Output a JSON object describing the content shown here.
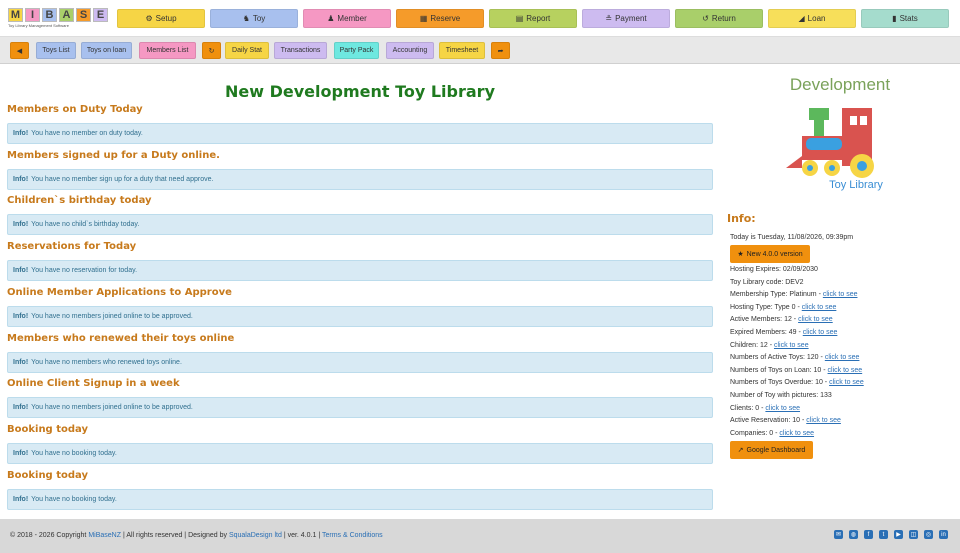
{
  "logo": {
    "letters": [
      "M",
      "I",
      "B",
      "A",
      "S",
      "E"
    ],
    "tagline": "Toy Library Management Software"
  },
  "nav": [
    {
      "label": "Setup",
      "icon": "gear-icon",
      "glyph": "⚙",
      "color": "#f6d545"
    },
    {
      "label": "Toy",
      "icon": "bicycle-icon",
      "glyph": "♞",
      "color": "#a8c0ee"
    },
    {
      "label": "Member",
      "icon": "users-icon",
      "glyph": "♟",
      "color": "#f598c3"
    },
    {
      "label": "Reserve",
      "icon": "calendar-icon",
      "glyph": "▦",
      "color": "#f59b2a"
    },
    {
      "label": "Report",
      "icon": "report-icon",
      "glyph": "▤",
      "color": "#b7d15f"
    },
    {
      "label": "Payment",
      "icon": "payment-icon",
      "glyph": "≗",
      "color": "#cdbbf0"
    },
    {
      "label": "Return",
      "icon": "return-icon",
      "glyph": "↺",
      "color": "#a9cf6a"
    },
    {
      "label": "Loan",
      "icon": "send-icon",
      "glyph": "◢",
      "color": "#f7df5a"
    },
    {
      "label": "Stats",
      "icon": "bar-chart-icon",
      "glyph": "▮",
      "color": "#a5dccd"
    }
  ],
  "subnav": [
    {
      "label": "",
      "name": "back-button",
      "glyph": "◀",
      "color": "#f0900e"
    },
    {
      "label": "Toys List",
      "name": "toys-list-button",
      "color": "#a8c0ee"
    },
    {
      "label": "Toys on loan",
      "name": "toys-on-loan-button",
      "color": "#a8c0ee"
    },
    {
      "label": "Members List",
      "name": "members-list-button",
      "color": "#f598c3"
    },
    {
      "label": "",
      "name": "refresh-button",
      "glyph": "↻",
      "color": "#f0900e"
    },
    {
      "label": "Daily Stat",
      "name": "daily-stat-button",
      "color": "#f6d545"
    },
    {
      "label": "Transactions",
      "name": "transactions-button",
      "color": "#cdbbf0"
    },
    {
      "label": "Party Pack",
      "name": "party-pack-button",
      "color": "#6ee8e0"
    },
    {
      "label": "Accounting",
      "name": "accounting-button",
      "color": "#cdbbf0"
    },
    {
      "label": "Timesheet",
      "name": "timesheet-button",
      "color": "#f6d545"
    },
    {
      "label": "",
      "name": "logout-button",
      "glyph": "➦",
      "color": "#f0900e"
    }
  ],
  "page_title": "New Development Toy Library",
  "sections": [
    {
      "heading": "Members on Duty Today",
      "info": "You have no member on duty today."
    },
    {
      "heading": "Members signed up for a Duty online.",
      "info": "You have no member sign up for a duty that need approve."
    },
    {
      "heading": "Children`s birthday today",
      "info": "You have no child`s birthday today."
    },
    {
      "heading": "Reservations for Today",
      "info": "You have no reservation for today."
    },
    {
      "heading": "Online Member Applications to Approve",
      "info": "You have no members joined online to be approved."
    },
    {
      "heading": "Members who renewed their toys online",
      "info": "You have no members who renewed toys online."
    },
    {
      "heading": "Online Client Signup in a week",
      "info": "You have no members joined online to be approved."
    },
    {
      "heading": "Booking today",
      "info": "You have no booking today."
    },
    {
      "heading": "Booking today",
      "info": "You have no booking today."
    }
  ],
  "info_label": "Info!",
  "toy_logo": {
    "top": "Development",
    "bottom": "Toy Library"
  },
  "info_panel": {
    "title": "Info:",
    "today": "Today is Tuesday, 11/08/2026, 09:39pm",
    "new_version_button": "New 4.0.0 version",
    "lines": [
      {
        "text": "Hosting Expires: 02/09/2030",
        "link": ""
      },
      {
        "text": "Toy Library code: DEV2",
        "link": ""
      },
      {
        "text": "Membership Type: Platinum - ",
        "link": "click to see"
      },
      {
        "text": "Hosting Type: Type 0 - ",
        "link": "click to see"
      },
      {
        "text": "Active Members: 12 - ",
        "link": "click to see"
      },
      {
        "text": "Expired Members: 49 - ",
        "link": "click to see"
      },
      {
        "text": "Children: 12 - ",
        "link": "click to see"
      },
      {
        "text": "Numbers of Active Toys: 120 - ",
        "link": "click to see"
      },
      {
        "text": "Numbers of Toys on Loan: 10 - ",
        "link": "click to see"
      },
      {
        "text": "Numbers of Toys Overdue: 10 - ",
        "link": "click to see"
      },
      {
        "text": "Number of Toy with pictures: 133",
        "link": ""
      },
      {
        "text": "Clients: 0 - ",
        "link": "click to see"
      },
      {
        "text": "Active Reservation: 10 - ",
        "link": "click to see"
      },
      {
        "text": "Companies: 0 - ",
        "link": "click to see"
      }
    ],
    "dashboard_button": "Google Dashboard"
  },
  "footer": {
    "copyright": "© 2018 - 2026 Copyright ",
    "brand": "MiBaseNZ",
    "rights": " | All rights reserved | Designed by ",
    "designer": "SqualaDesign ltd",
    "version": " | ver. 4.0.1 | ",
    "terms": "Terms & Conditions",
    "social": [
      "email-icon",
      "globe-icon",
      "facebook-icon",
      "twitter-icon",
      "youtube-icon",
      "map-icon",
      "instagram-icon",
      "linkedin-icon"
    ]
  }
}
